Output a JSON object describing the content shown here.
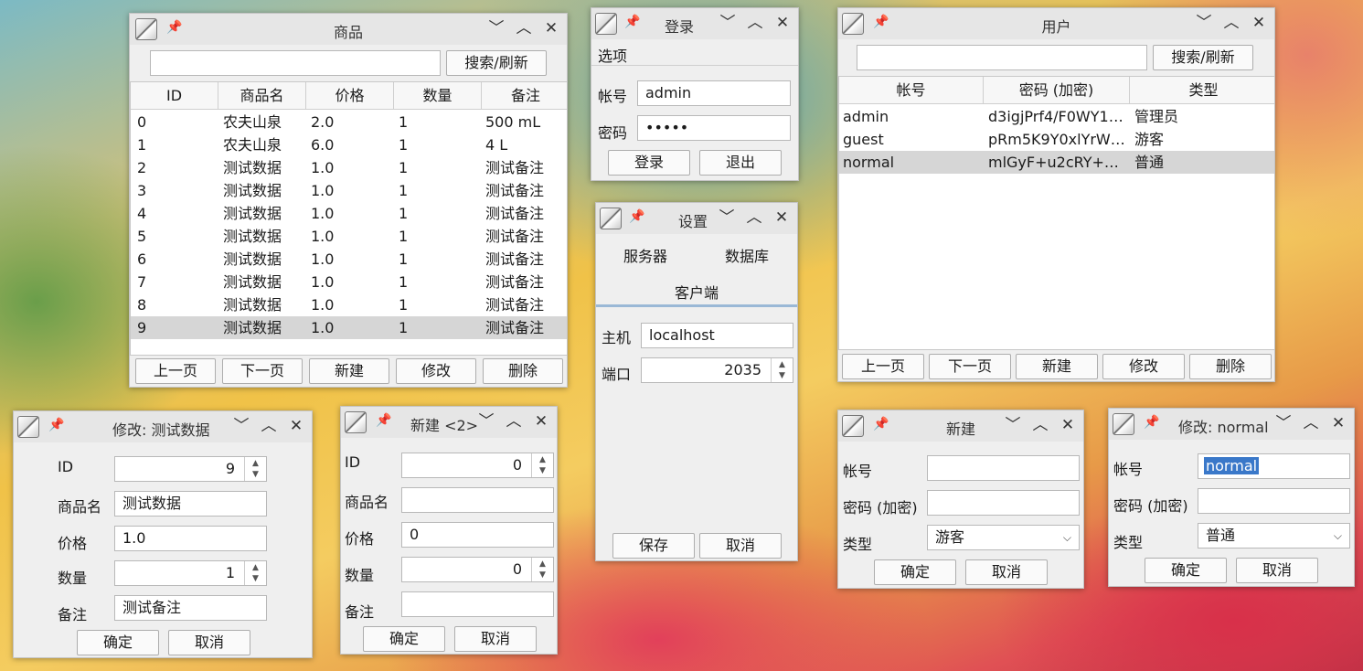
{
  "products": {
    "title": "商品",
    "search_placeholder": "",
    "search_label": "搜索/刷新",
    "headers": [
      "ID",
      "商品名",
      "价格",
      "数量",
      "备注"
    ],
    "rows": [
      [
        "0",
        "农夫山泉",
        "2.0",
        "1",
        "500 mL"
      ],
      [
        "1",
        "农夫山泉",
        "6.0",
        "1",
        "4 L"
      ],
      [
        "2",
        "测试数据",
        "1.0",
        "1",
        "测试备注"
      ],
      [
        "3",
        "测试数据",
        "1.0",
        "1",
        "测试备注"
      ],
      [
        "4",
        "测试数据",
        "1.0",
        "1",
        "测试备注"
      ],
      [
        "5",
        "测试数据",
        "1.0",
        "1",
        "测试备注"
      ],
      [
        "6",
        "测试数据",
        "1.0",
        "1",
        "测试备注"
      ],
      [
        "7",
        "测试数据",
        "1.0",
        "1",
        "测试备注"
      ],
      [
        "8",
        "测试数据",
        "1.0",
        "1",
        "测试备注"
      ],
      [
        "9",
        "测试数据",
        "1.0",
        "1",
        "测试备注"
      ]
    ],
    "selected_row": 9,
    "buttons": {
      "prev": "上一页",
      "next": "下一页",
      "new": "新建",
      "edit": "修改",
      "delete": "删除"
    }
  },
  "login": {
    "title": "登录",
    "menu": "选项",
    "account_label": "帐号",
    "account_value": "admin",
    "password_label": "密码",
    "password_value": "•••••",
    "login_button": "登录",
    "exit_button": "退出"
  },
  "users": {
    "title": "用户",
    "search_placeholder": "",
    "search_label": "搜索/刷新",
    "headers": [
      "帐号",
      "密码 (加密)",
      "类型"
    ],
    "rows": [
      [
        "admin",
        "d3igjPrf4/F0WY1R…",
        "管理员"
      ],
      [
        "guest",
        "pRm5K9Y0xlYrWE…",
        "游客"
      ],
      [
        "normal",
        "mlGyF+u2cRY+WC…",
        "普通"
      ]
    ],
    "selected_row": 2,
    "buttons": {
      "prev": "上一页",
      "next": "下一页",
      "new": "新建",
      "edit": "修改",
      "delete": "删除"
    }
  },
  "settings": {
    "title": "设置",
    "tabs": [
      "服务器",
      "数据库",
      "客户端"
    ],
    "active_tab": 2,
    "host_label": "主机",
    "host_value": "localhost",
    "port_label": "端口",
    "port_value": "2035",
    "save_button": "保存",
    "cancel_button": "取消"
  },
  "edit_product": {
    "title": "修改: 测试数据",
    "id_label": "ID",
    "id_value": "9",
    "name_label": "商品名",
    "name_value": "测试数据",
    "price_label": "价格",
    "price_value": "1.0",
    "qty_label": "数量",
    "qty_value": "1",
    "note_label": "备注",
    "note_value": "测试备注",
    "ok_button": "确定",
    "cancel_button": "取消"
  },
  "new_product": {
    "title": "新建 <2>",
    "id_label": "ID",
    "id_value": "0",
    "name_label": "商品名",
    "name_value": "",
    "price_label": "价格",
    "price_value": "0",
    "qty_label": "数量",
    "qty_value": "0",
    "note_label": "备注",
    "note_value": "",
    "ok_button": "确定",
    "cancel_button": "取消"
  },
  "new_user": {
    "title": "新建",
    "account_label": "帐号",
    "account_value": "",
    "password_label": "密码 (加密)",
    "password_value": "",
    "type_label": "类型",
    "type_value": "游客",
    "ok_button": "确定",
    "cancel_button": "取消"
  },
  "edit_user": {
    "title": "修改: normal",
    "account_label": "帐号",
    "account_value": "normal",
    "password_label": "密码 (加密)",
    "password_value": "",
    "type_label": "类型",
    "type_value": "普通",
    "ok_button": "确定",
    "cancel_button": "取消"
  },
  "titlebar_icons": {
    "app": "duke-app-icon",
    "pin": "pin-icon",
    "minimize": "chevron-down-icon",
    "maximize": "chevron-up-icon",
    "close": "close-icon"
  },
  "colors": {
    "window_bg": "#efefef",
    "titlebar": "#e6e6e6",
    "selection": "#d6d6d6",
    "text_selection": "#3a78c9"
  }
}
